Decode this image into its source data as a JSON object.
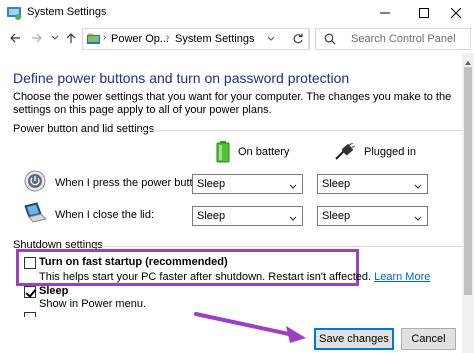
{
  "window": {
    "title": "System Settings",
    "controls": [
      "minimize",
      "maximize",
      "close"
    ]
  },
  "nav": {
    "breadcrumbs": [
      "Power Op...",
      "System Settings"
    ],
    "search_placeholder": "Search Control Panel"
  },
  "page": {
    "heading": "Define power buttons and turn on password protection",
    "description": "Choose the power settings that you want for your computer. The changes you make to the settings on this page apply to all of your power plans."
  },
  "power_group": {
    "label": "Power button and lid settings",
    "columns": [
      "On battery",
      "Plugged in"
    ],
    "rows": [
      {
        "label": "When I press the power button:",
        "on_battery": "Sleep",
        "plugged_in": "Sleep"
      },
      {
        "label": "When I close the lid:",
        "on_battery": "Sleep",
        "plugged_in": "Sleep"
      }
    ]
  },
  "shutdown_group": {
    "label": "Shutdown settings",
    "fast_startup": {
      "title": "Turn on fast startup (recommended)",
      "desc": "This helps start your PC faster after shutdown. Restart isn't affected.",
      "link": "Learn More",
      "checked": false
    },
    "sleep": {
      "title": "Sleep",
      "desc": "Show in Power menu.",
      "checked": true
    }
  },
  "footer": {
    "save": "Save changes",
    "cancel": "Cancel"
  },
  "colors": {
    "heading": "#1e3287",
    "highlight": "#9b3fc4",
    "link": "#0066cc",
    "focus": "#0078d7"
  }
}
